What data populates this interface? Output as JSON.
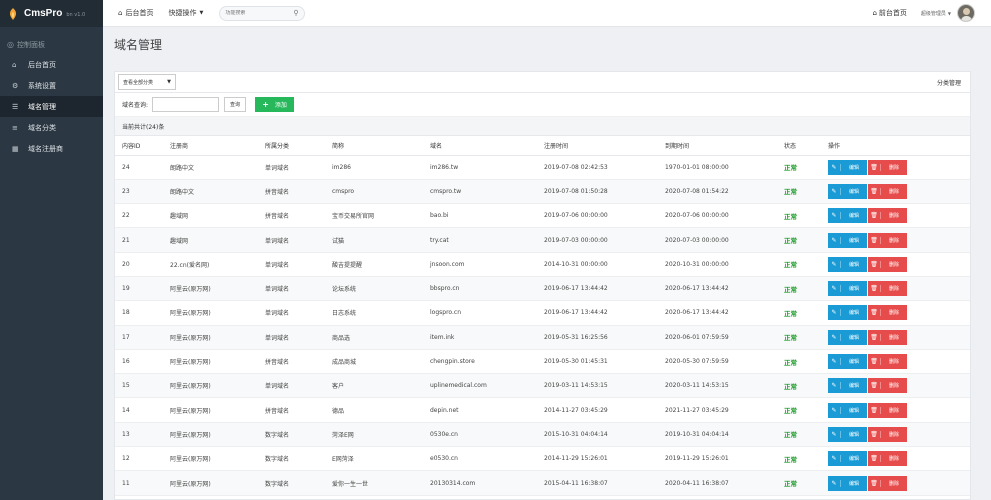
{
  "brand": {
    "name": "CmsPro",
    "version": "bn v1.0"
  },
  "sidebar": {
    "heading": "控制面板",
    "items": [
      {
        "label": "后台首页",
        "icon": "home-icon",
        "glyph": "⌂"
      },
      {
        "label": "系统设置",
        "icon": "gear-icon",
        "glyph": "⚙"
      },
      {
        "label": "域名管理",
        "icon": "list-icon",
        "glyph": "☰",
        "active": true
      },
      {
        "label": "域名分类",
        "icon": "sliders-icon",
        "glyph": "≡"
      },
      {
        "label": "域名注册商",
        "icon": "grid-icon",
        "glyph": "▦"
      }
    ]
  },
  "topbar": {
    "home": "后台首页",
    "quick_ops": "快捷操作",
    "search_placeholder": "功能搜索",
    "front_home": "前台首页",
    "user": "超级管理员"
  },
  "page": {
    "title": "域名管理"
  },
  "panel": {
    "category_select": "查看全部分类",
    "category_manage": "分类管理",
    "query_label": "域名查询:",
    "query_value": "",
    "query_button": "查询",
    "add_button": "添加",
    "total": "当前共计(24)条"
  },
  "table": {
    "columns": [
      "内容ID",
      "注册商",
      "所属分类",
      "简称",
      "域名",
      "注册时间",
      "到期时间",
      "状态",
      "操作"
    ],
    "edit_label": "编辑",
    "delete_label": "删除",
    "rows": [
      [
        "24",
        "朗路中文",
        "单词域名",
        "im286",
        "im286.tw",
        "2019-07-08 02:42:53",
        "1970-01-01 08:00:00",
        "正常"
      ],
      [
        "23",
        "朗路中文",
        "拼音域名",
        "cmspro",
        "cmspro.tw",
        "2019-07-08 01:50:28",
        "2020-07-08 01:54:22",
        "正常"
      ],
      [
        "22",
        "趣域网",
        "拼音域名",
        "宝币交易所官网",
        "bao.bi",
        "2019-07-06 00:00:00",
        "2020-07-06 00:00:00",
        "正常"
      ],
      [
        "21",
        "趣域网",
        "单词域名",
        "试猫",
        "try.cat",
        "2019-07-03 00:00:00",
        "2020-07-03 00:00:00",
        "正常"
      ],
      [
        "20",
        "22.cn(爱名网)",
        "单词域名",
        "酸吉提提醒",
        "jnsoon.com",
        "2014-10-31 00:00:00",
        "2020-10-31 00:00:00",
        "正常"
      ],
      [
        "19",
        "阿里云(原万网)",
        "单词域名",
        "论坛系统",
        "bbspro.cn",
        "2019-06-17 13:44:42",
        "2020-06-17 13:44:42",
        "正常"
      ],
      [
        "18",
        "阿里云(原万网)",
        "单词域名",
        "日志系统",
        "logspro.cn",
        "2019-06-17 13:44:42",
        "2020-06-17 13:44:42",
        "正常"
      ],
      [
        "17",
        "阿里云(原万网)",
        "单词域名",
        "商品选",
        "item.ink",
        "2019-05-31 16:25:56",
        "2020-06-01 07:59:59",
        "正常"
      ],
      [
        "16",
        "阿里云(原万网)",
        "拼音域名",
        "成品商城",
        "chengpin.store",
        "2019-05-30 01:45:31",
        "2020-05-30 07:59:59",
        "正常"
      ],
      [
        "15",
        "阿里云(原万网)",
        "单词域名",
        "客户",
        "uplinemedical.com",
        "2019-03-11 14:53:15",
        "2020-03-11 14:53:15",
        "正常"
      ],
      [
        "14",
        "阿里云(原万网)",
        "拼音域名",
        "德品",
        "depin.net",
        "2014-11-27 03:45:29",
        "2021-11-27 03:45:29",
        "正常"
      ],
      [
        "13",
        "阿里云(原万网)",
        "数字域名",
        "菏泽E网",
        "0530e.cn",
        "2015-10-31 04:04:14",
        "2019-10-31 04:04:14",
        "正常"
      ],
      [
        "12",
        "阿里云(原万网)",
        "数字域名",
        "E网菏泽",
        "e0530.cn",
        "2014-11-29 15:26:01",
        "2019-11-29 15:26:01",
        "正常"
      ],
      [
        "11",
        "阿里云(原万网)",
        "数字域名",
        "爱你一生一世",
        "20130314.com",
        "2015-04-11 16:38:07",
        "2020-04-11 16:38:07",
        "正常"
      ]
    ]
  }
}
